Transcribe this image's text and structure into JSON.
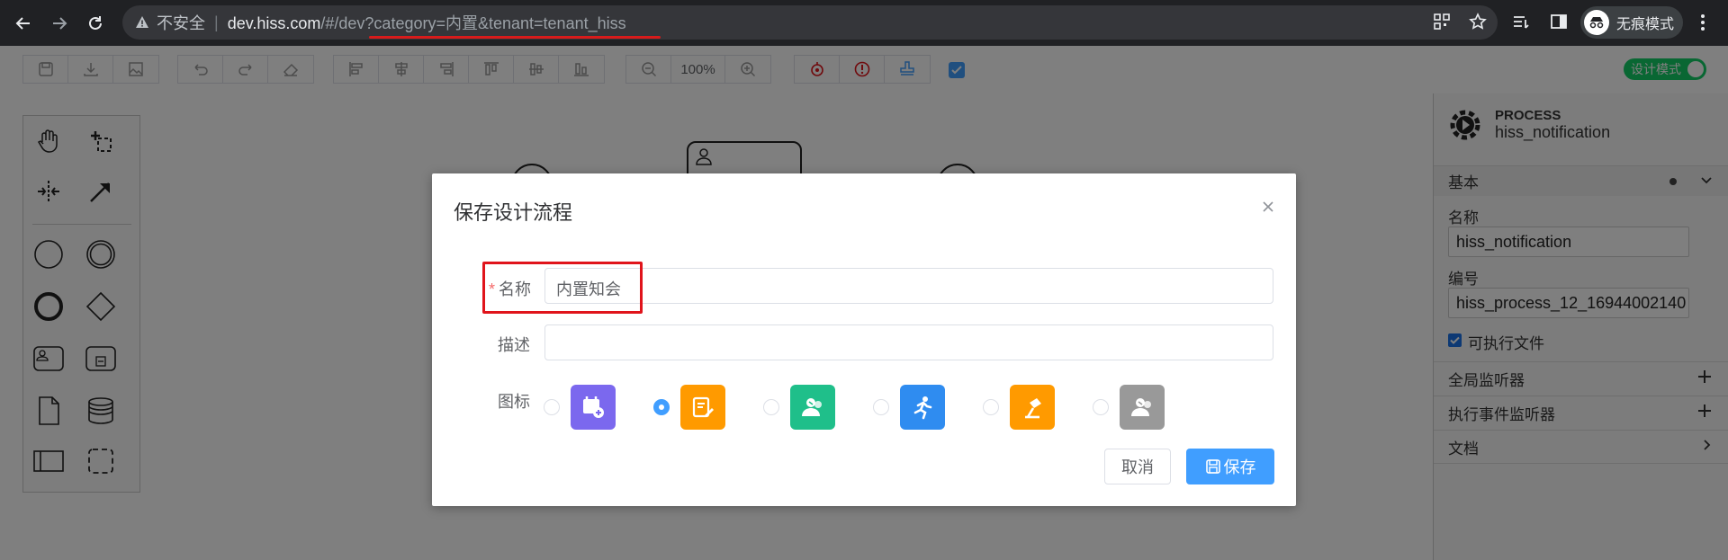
{
  "browser": {
    "security_label": "不安全",
    "url_host": "dev.hiss.com",
    "url_path": "/#/dev?category=内置&tenant=tenant_hiss",
    "incognito_label": "无痕模式"
  },
  "toolbar": {
    "zoom": "100%",
    "design_mode_label": "设计模式"
  },
  "panel": {
    "type_label": "PROCESS",
    "process_name": "hiss_notification",
    "group_basic": "基本",
    "name_label": "名称",
    "name_value": "hiss_notification",
    "id_label": "编号",
    "id_value": "hiss_process_12_16944002140",
    "executable_label": "可执行文件",
    "global_listener": "全局监听器",
    "exec_event_listener": "执行事件监听器",
    "docs": "文档"
  },
  "modal": {
    "title": "保存设计流程",
    "required_mark": "*",
    "name_label": "名称",
    "name_value": "内置知会",
    "desc_label": "描述",
    "desc_value": "",
    "icon_label": "图标",
    "icons": [
      {
        "name": "calendar-add-icon",
        "color": "#7b68ee",
        "selected": false
      },
      {
        "name": "form-edit-icon",
        "color": "#ff9a00",
        "selected": true
      },
      {
        "name": "user-group-icon",
        "color": "#1fbf8a",
        "selected": false
      },
      {
        "name": "runner-icon",
        "color": "#2f8cf0",
        "selected": false
      },
      {
        "name": "lamp-icon",
        "color": "#ff9a00",
        "selected": false
      },
      {
        "name": "user-group-gray-icon",
        "color": "#999999",
        "selected": false
      }
    ],
    "cancel_label": "取消",
    "save_label": "保存"
  },
  "colors": {
    "primary": "#409eff",
    "accent_red": "#e0141b",
    "toggle_green": "#13ce66"
  }
}
